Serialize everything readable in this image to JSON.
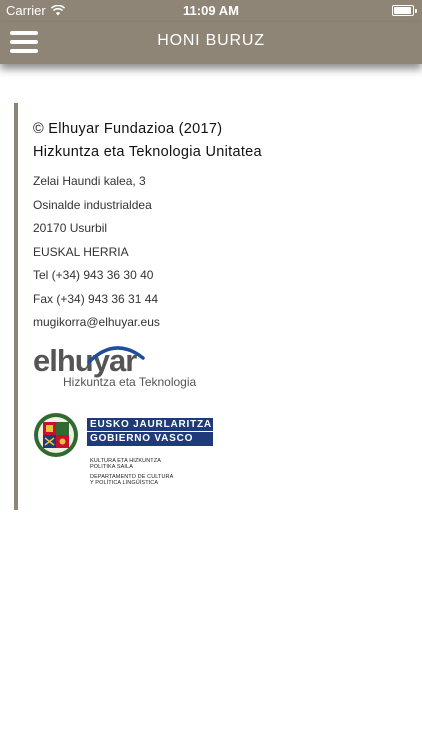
{
  "status_bar": {
    "carrier": "Carrier",
    "time": "11:09 AM",
    "battery_level": 0.95
  },
  "nav": {
    "title": "HONI BURUZ",
    "menu_icon": "hamburger-menu-icon"
  },
  "about": {
    "copyright": "© Elhuyar Fundazioa (2017)",
    "unit": "Hizkuntza eta Teknologia Unitatea",
    "address_lines": [
      "Zelai Haundi kalea, 3",
      "Osinalde industrialdea",
      "20170 Usurbil",
      "EUSKAL HERRIA",
      "Tel (+34) 943 36 30 40",
      "Fax (+34) 943 36 31 44",
      "mugikorra@elhuyar.eus"
    ]
  },
  "logos": {
    "elhuyar": {
      "name": "elhuyar",
      "tagline": "Hizkuntza eta Teknologia"
    },
    "gobierno_vasco": {
      "line1": "EUSKO JAURLARITZA",
      "line2": "GOBIERNO VASCO",
      "dept_eu_1": "KULTURA ETA HIZKUNTZA",
      "dept_eu_2": "POLITIKA SAILA",
      "dept_es_1": "DEPARTAMENTO DE CULTURA",
      "dept_es_2": "Y POLÍTICA LINGÜÍSTICA"
    }
  },
  "colors": {
    "bar": "#8f8577",
    "gv_blue": "#1f3a7a",
    "elhuyar_arc": "#1f4e9a"
  }
}
